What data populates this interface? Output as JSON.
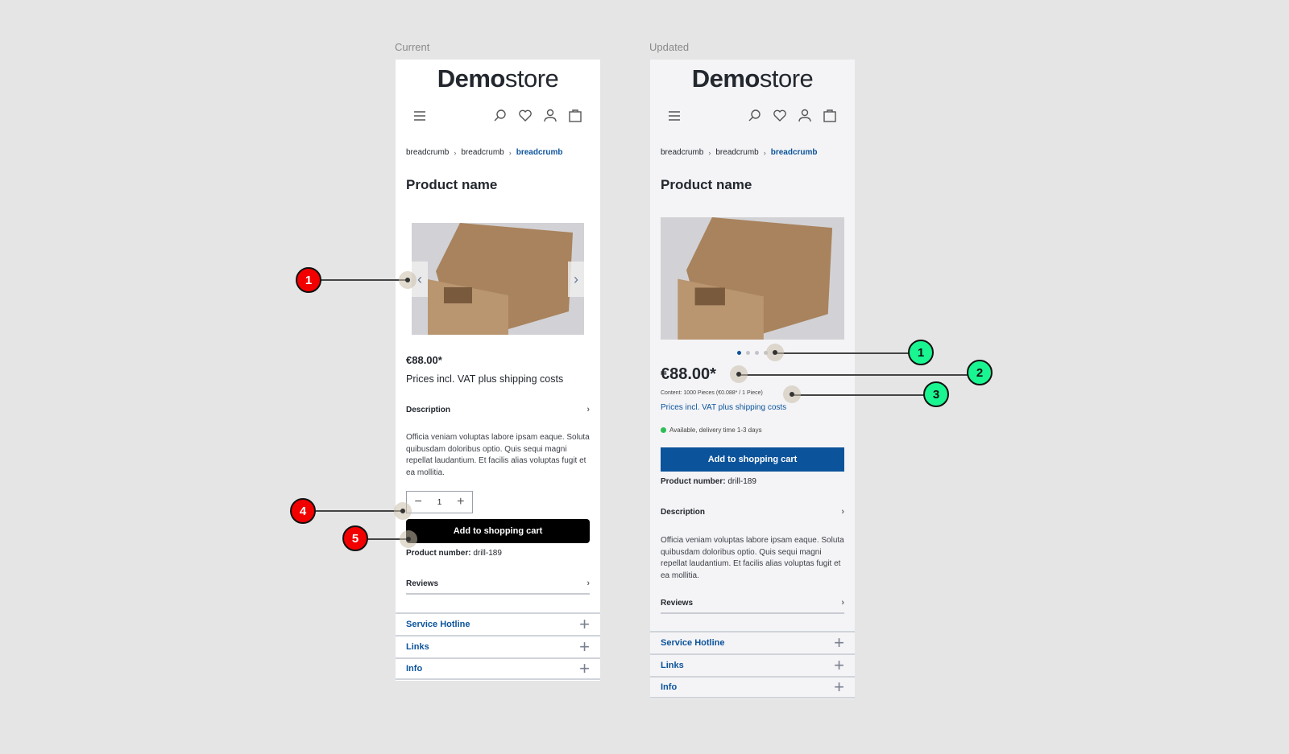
{
  "frames": {
    "current_label": "Current",
    "updated_label": "Updated"
  },
  "store": {
    "logo_bold": "Demo",
    "logo_light": "store",
    "icons": [
      "menu-icon",
      "search-icon",
      "heart-icon",
      "user-icon",
      "bag-icon"
    ]
  },
  "breadcrumb": [
    "breadcrumb",
    "breadcrumb",
    "breadcrumb"
  ],
  "product": {
    "name": "Product name",
    "price": "€88.00*",
    "vat_note": "Prices incl. VAT plus shipping costs",
    "content": "Content: 1000 Pieces (€0.088* / 1 Piece)",
    "availability": "Available, delivery time 1-3 days",
    "availability_color": "#2dbd55",
    "quantity": "1",
    "add_to_cart": "Add to shopping cart",
    "number_label": "Product number:",
    "number_value": "drill-189",
    "description_label": "Description",
    "description_text": "Officia veniam voluptas labore ipsam eaque. Soluta quibusdam doloribus optio. Quis sequi magni repellat laudantium. Et facilis alias voluptas fugit et ea mollitia.",
    "reviews_label": "Reviews",
    "gallery_dots": 4,
    "gallery_active_dot": 1
  },
  "footer": [
    "Service Hotline",
    "Links",
    "Info"
  ],
  "colors": {
    "brand_blue": "#0b539b",
    "current_cart_bg": "#000000",
    "updated_cart_bg": "#0b539b",
    "callout_red": "#f20000",
    "callout_green": "#19f590"
  },
  "callouts": {
    "current": [
      "1",
      "4",
      "5"
    ],
    "updated": [
      "1",
      "2",
      "3"
    ]
  }
}
